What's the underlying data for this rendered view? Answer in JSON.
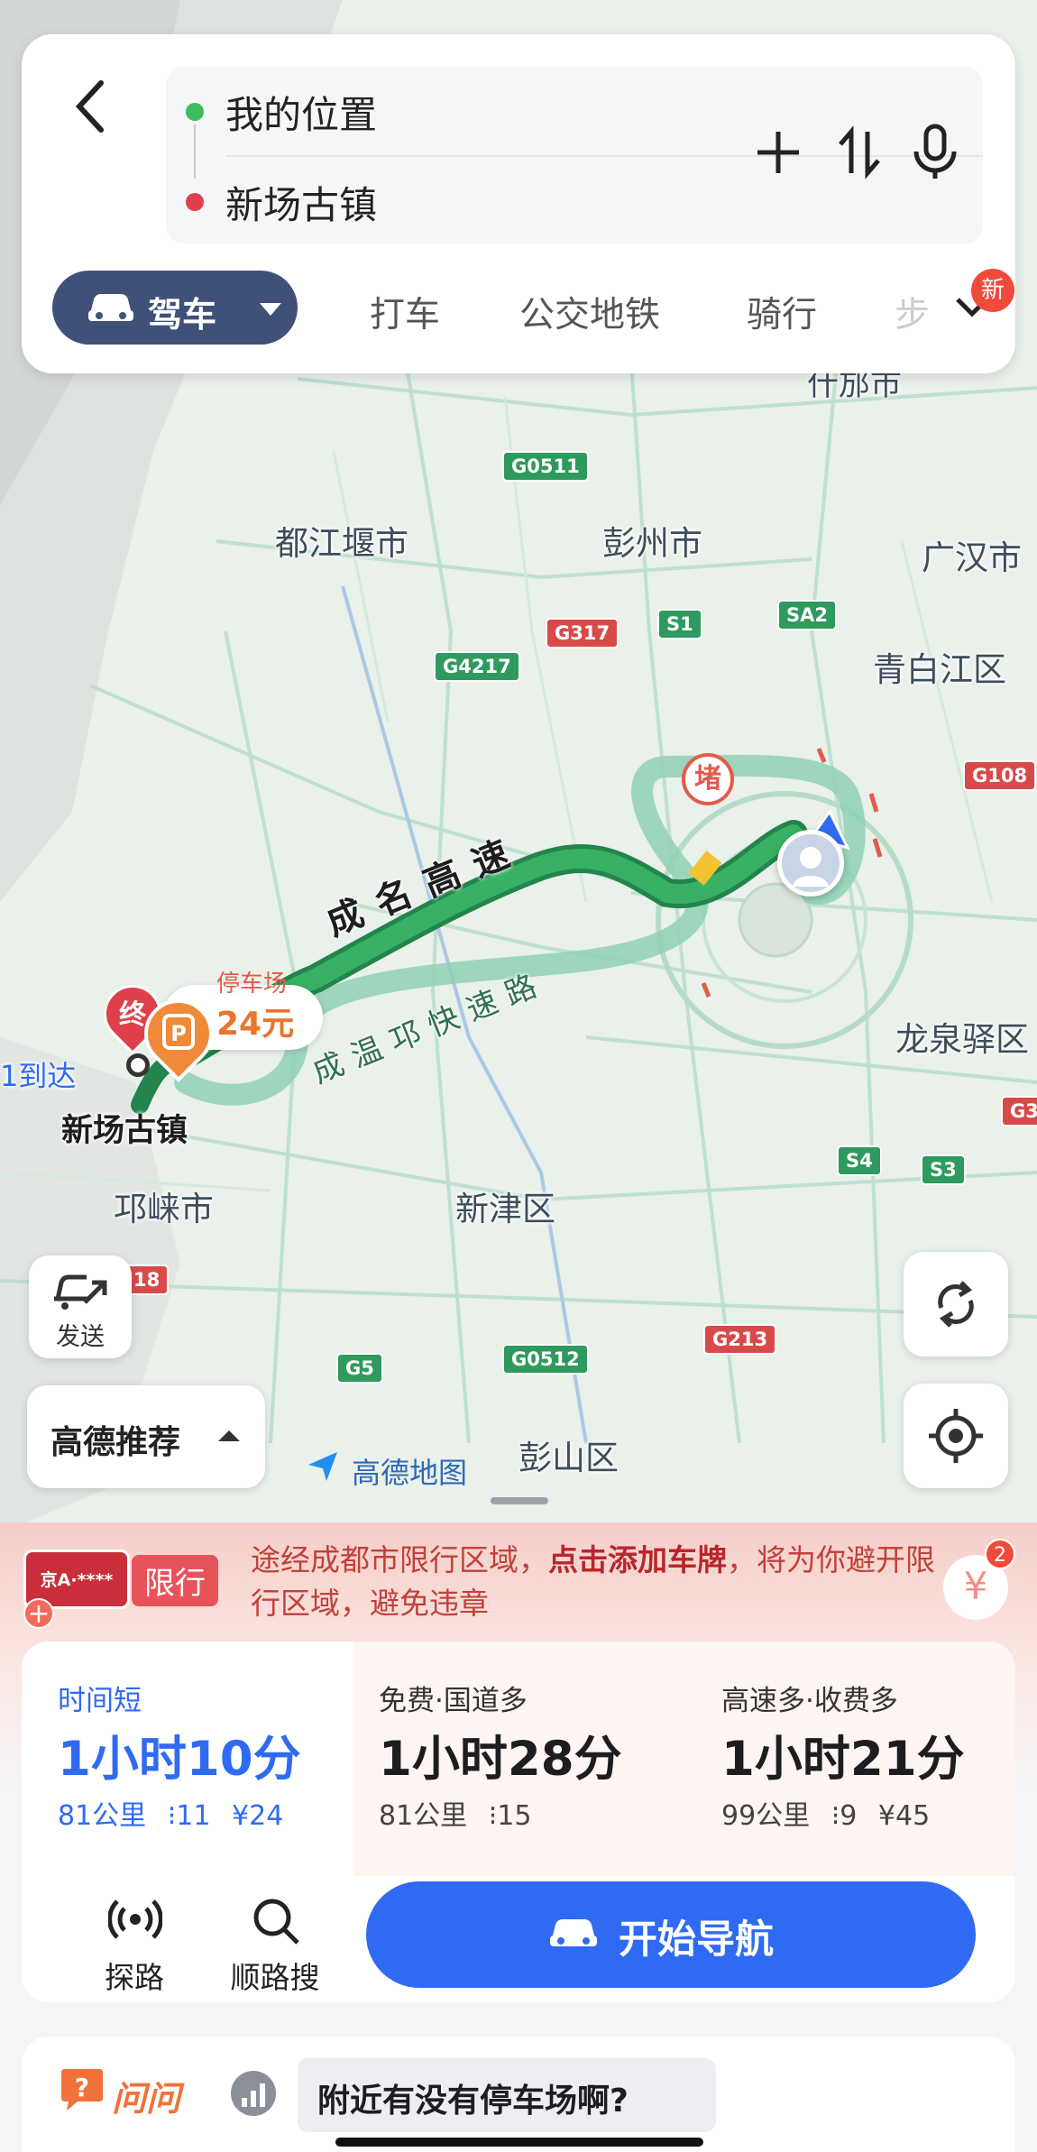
{
  "search": {
    "origin": "我的位置",
    "destination": "新场古镇"
  },
  "modes": {
    "drive": "驾车",
    "taxi": "打车",
    "transit": "公交地铁",
    "ride": "骑行",
    "more_partial": "步",
    "new_badge": "新"
  },
  "map": {
    "places": {
      "shifang": "什邡市",
      "dujiangyan": "都江堰市",
      "pengzhou": "彭州市",
      "guanghan": "广汉市",
      "qingbaijiang": "青白江区",
      "longquanyi": "龙泉驿区",
      "qionglai": "邛崃市",
      "xinjin": "新津区",
      "pengshan": "彭山区",
      "destination_label": "新场古镇",
      "arrive_partial": "1到达"
    },
    "shields": {
      "g0511": "G0511",
      "g317": "G317",
      "s1": "S1",
      "sa2": "SA2",
      "g4217": "G4217",
      "g108": "G108",
      "s4": "S4",
      "s3": "S3",
      "g213": "G213",
      "g5": "G5",
      "g0512": "G0512",
      "g318_partial": "18",
      "g3_partial": "G3"
    },
    "road_labels": {
      "chengming": "成名高速",
      "chengwenqiong": "成温邛快速路"
    },
    "congestion": "堵",
    "end_marker": "终",
    "parking_price": "24元",
    "parking_partial": "停车场",
    "send_label": "发送",
    "recommend": "高德推荐",
    "logo": "高德地图"
  },
  "notice": {
    "plate": "京A·****",
    "tag": "限行",
    "text_before": "途经成都市限行区域，",
    "text_bold": "点击添加车牌",
    "text_after": "，将为你避开限行区域，避免违章",
    "coupon_badge": "2",
    "coupon_icon": "¥"
  },
  "routes": [
    {
      "label": "时间短",
      "time": "1小时10分",
      "distance": "81公里",
      "lights": "11",
      "cost": "¥24"
    },
    {
      "label": "免费·国道多",
      "time": "1小时28分",
      "distance": "81公里",
      "lights": "15",
      "cost": ""
    },
    {
      "label": "高速多·收费多",
      "time": "1小时21分",
      "distance": "99公里",
      "lights": "9",
      "cost": "¥45"
    }
  ],
  "actions": {
    "explore": "探路",
    "search_along": "顺路搜",
    "start": "开始导航"
  },
  "ask": {
    "brand": "问问",
    "prompt": "附近有没有停车场啊?"
  },
  "colors": {
    "accent": "#2f6bf2",
    "drive_pill": "#3f5079",
    "route_green": "#2e9a5d",
    "alt_route": "#8fd1b4",
    "warning_red": "#c0413a"
  }
}
